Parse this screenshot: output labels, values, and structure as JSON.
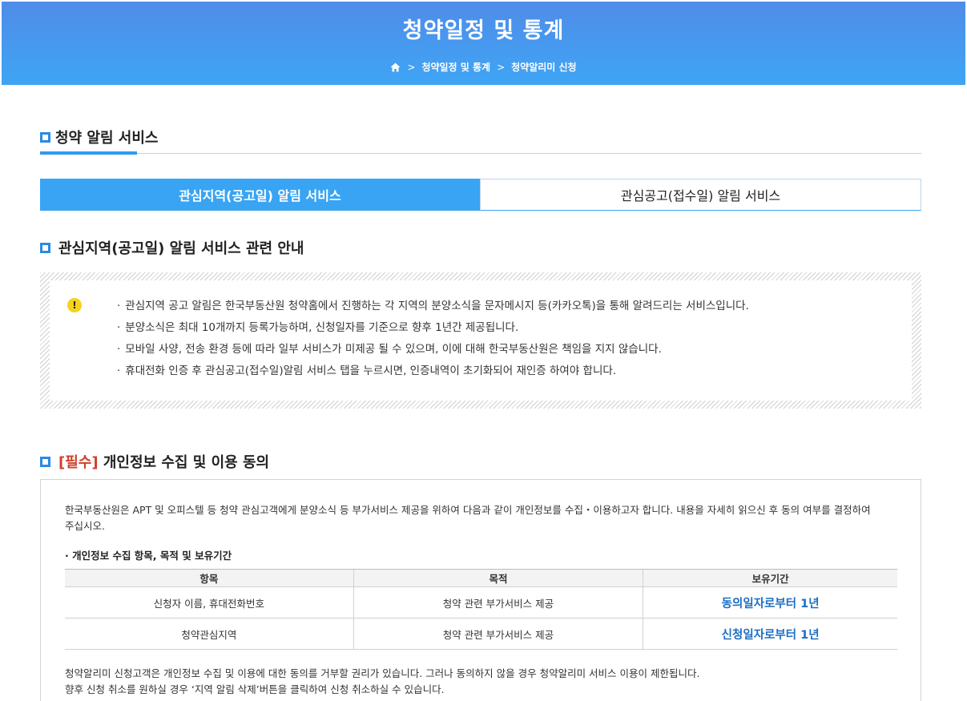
{
  "header": {
    "title": "청약일정 및 통계",
    "breadcrumb": [
      "청약일정 및 통계",
      "청약알리미 신청"
    ],
    "home_icon": "home-icon",
    "separator_icon": "chevron-right-icon"
  },
  "section": {
    "title": "청약 알림 서비스"
  },
  "tabs": [
    {
      "label": "관심지역(공고일) 알림 서비스",
      "active": true
    },
    {
      "label": "관심공고(접수일) 알림 서비스",
      "active": false
    }
  ],
  "notice": {
    "title": "관심지역(공고일) 알림 서비스 관련 안내",
    "icon": "warning-icon",
    "items": [
      "관심지역 공고 알림은 한국부동산원 청약홈에서 진행하는 각 지역의 분양소식을 문자메시지 등(카카오톡)을 통해 알려드리는 서비스입니다.",
      "분양소식은 최대 10개까지 등록가능하며, 신청일자를 기준으로 향후 1년간 제공됩니다.",
      "모바일 사양, 전송 환경 등에 따라 일부 서비스가 미제공 될 수 있으며, 이에 대해 한국부동산원은 책임을 지지 않습니다.",
      "휴대전화 인증 후 관심공고(접수일)알림 서비스 탭을 누르시면, 인증내역이 초기화되어 재인증 하여야 합니다."
    ]
  },
  "privacy": {
    "required_tag": "[필수]",
    "title": "개인정보 수집 및 이용 동의",
    "intro": "한국부동산원은 APT 및 오피스텔 등 청약 관심고객에게 분양소식 등 부가서비스 제공을 위하여 다음과 같이 개인정보를 수집・이용하고자 합니다. 내용을 자세히 읽으신 후 동의 여부를 결정하여 주십시오.",
    "subheading": "· 개인정보 수집 항목, 목적 및 보유기간",
    "table": {
      "headers": [
        "항목",
        "목적",
        "보유기간"
      ],
      "rows": [
        [
          "신청자 이름, 휴대전화번호",
          "청약 관련 부가서비스 제공",
          "동의일자로부터 1년"
        ],
        [
          "청약관심지역",
          "청약 관련 부가서비스 제공",
          "신청일자로부터 1년"
        ]
      ]
    },
    "footer": [
      "청약알리미 신청고객은 개인정보 수집 및 이용에 대한 동의를 거부할 권리가 있습니다. 그러나 동의하지 않을 경우 청약알리미 서비스 이용이 제한됩니다.",
      "향후 신청 취소를 원하실 경우 ‘지역 알림 삭제’버튼을 클릭하여 신청 취소하실 수 있습니다."
    ]
  },
  "colors": {
    "header_gradient_top": "#4f8ce8",
    "header_gradient_bottom": "#3fa5f5",
    "active_tab": "#39a4f3",
    "accent": "#2a8ae6",
    "required": "#d0402a",
    "retention_text": "#1c6ec4",
    "warning": "#f6d21a"
  }
}
